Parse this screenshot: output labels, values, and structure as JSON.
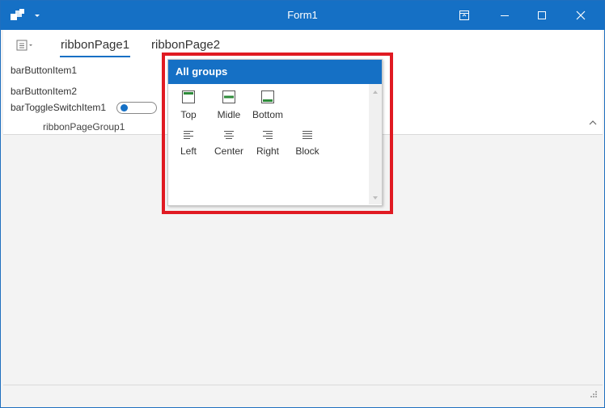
{
  "window": {
    "title": "Form1",
    "accent": "#1570c5"
  },
  "ribbon": {
    "tabs": [
      {
        "label": "ribbonPage1",
        "active": true
      },
      {
        "label": "ribbonPage2",
        "active": false
      }
    ],
    "items": {
      "bar_button_1": "barButtonItem1",
      "bar_button_2": "barButtonItem2",
      "toggle_switch": "barToggleSwitchItem1",
      "toggle_on": false
    },
    "group_caption": "ribbonPageGroup1"
  },
  "gallery": {
    "header": "All groups",
    "items": [
      {
        "label": "Top",
        "icon": "align-top-icon"
      },
      {
        "label": "Midle",
        "icon": "align-middle-icon"
      },
      {
        "label": "Bottom",
        "icon": "align-bottom-icon"
      },
      {
        "label": "Left",
        "icon": "text-align-left-icon"
      },
      {
        "label": "Center",
        "icon": "text-align-center-icon"
      },
      {
        "label": "Right",
        "icon": "text-align-right-icon"
      },
      {
        "label": "Block",
        "icon": "text-justify-icon"
      }
    ],
    "highlight_color": "#e01a22"
  }
}
